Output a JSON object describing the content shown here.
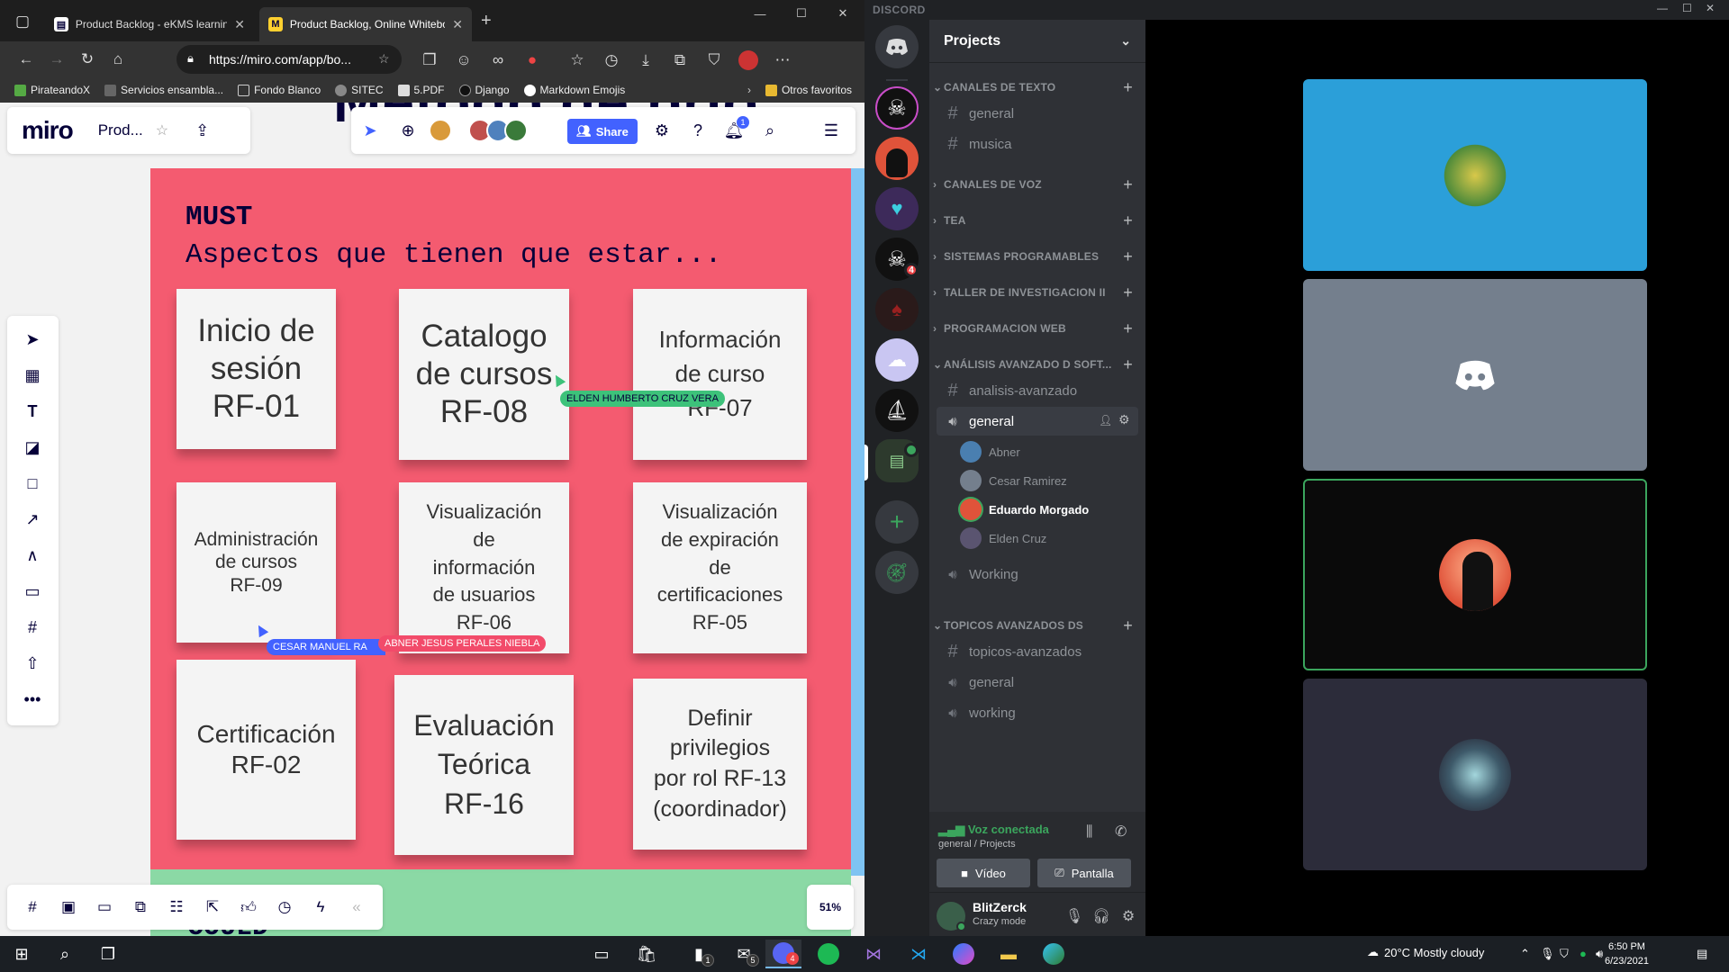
{
  "browser": {
    "tabs": [
      {
        "title": "Product Backlog - eKMS learning",
        "icon": "page-icon"
      },
      {
        "title": "Product Backlog, Online Whitebo",
        "icon": "miro-icon"
      }
    ],
    "url": "https://miro.com/app/bo...",
    "bookmarks": [
      "PirateandoX",
      "Servicios ensambla...",
      "Fondo Blanco",
      "SITEC",
      "5.PDF",
      "Django",
      "Markdown Emojis"
    ],
    "other_favorites": "Otros favoritos"
  },
  "miro": {
    "logo": "miro",
    "board_name": "Prod...",
    "top_frame_text": "Método de prio",
    "share_label": "Share",
    "notification_count": "1",
    "zoom": "51%",
    "must_title": "MUST",
    "must_subtitle": "Aspectos que tienen que estar...",
    "could_label": "COULD",
    "stickies": [
      {
        "text": "Inicio de\nsesión\nRF-01"
      },
      {
        "text": "Catalogo\nde cursos\nRF-08"
      },
      {
        "text": "Información\nde curso\nRF-07"
      },
      {
        "text": "Administración\nde cursos\nRF-09"
      },
      {
        "text": "Visualización\nde\ninformación\nde usuarios\nRF-06"
      },
      {
        "text": "Visualización\nde expiración\nde\ncertificaciones\nRF-05"
      },
      {
        "text": "Certificación\nRF-02"
      },
      {
        "text": "Evaluación\nTeórica\nRF-16"
      },
      {
        "text": "Definir\nprivilegios\npor rol RF-13\n(coordinador)"
      }
    ],
    "cursors": [
      {
        "name": "ELDEN HUMBERTO CRUZ VERA",
        "color": "#3dc27a"
      },
      {
        "name": "CESAR MANUEL RA",
        "color": "#4262ff"
      },
      {
        "name": "ABNER JESUS PERALES NIEBLA",
        "color": "#f24b6a"
      }
    ]
  },
  "discord": {
    "brand": "DISCORD",
    "server_name": "Projects",
    "server_badge": "4",
    "categories": [
      {
        "name": "CANALES DE TEXTO",
        "channels": [
          {
            "name": "general",
            "type": "text"
          },
          {
            "name": "musica",
            "type": "text"
          }
        ]
      },
      {
        "name": "CANALES DE VOZ",
        "channels": []
      },
      {
        "name": "TEA",
        "channels": []
      },
      {
        "name": "SISTEMAS PROGRAMABLES",
        "channels": []
      },
      {
        "name": "TALLER DE INVESTIGACION II",
        "channels": []
      },
      {
        "name": "PROGRAMACION WEB",
        "channels": []
      },
      {
        "name": "ANÁLISIS AVANZADO D SOFT...",
        "channels": [
          {
            "name": "analisis-avanzado",
            "type": "text"
          },
          {
            "name": "general",
            "type": "voice"
          }
        ]
      },
      {
        "name": "TOPICOS AVANZADOS DS",
        "channels": [
          {
            "name": "topicos-avanzados",
            "type": "text"
          },
          {
            "name": "general",
            "type": "voice"
          },
          {
            "name": "working",
            "type": "voice"
          }
        ]
      }
    ],
    "voice_members": [
      "Abner",
      "Cesar Ramirez",
      "Eduardo Morgado",
      "Elden Cruz"
    ],
    "working_channel": "Working",
    "voice_status": "Voz conectada",
    "voice_location": "general / Projects",
    "video_label": "Vídeo",
    "screen_label": "Pantalla",
    "user": {
      "name": "BlitZerck",
      "status": "Crazy mode"
    },
    "colors": {
      "accent": "#5865f2",
      "online": "#3ba55d",
      "tile_blue": "#2b9fd9",
      "tile_gray": "#747f8d"
    }
  },
  "taskbar": {
    "weather": "20°C  Mostly cloudy",
    "time": "6:50 PM",
    "date": "6/23/2021",
    "badges": {
      "files": "1",
      "mail": "5",
      "discord": "4"
    }
  }
}
